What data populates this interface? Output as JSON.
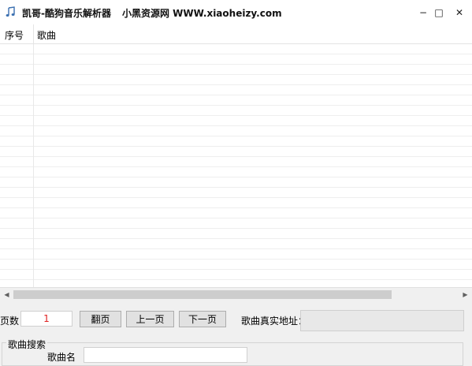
{
  "window": {
    "app_name": "凯哥-酷狗音乐解析器",
    "site_text": "小黑资源网 WWW.xiaoheizy.com",
    "minimize_glyph": "−",
    "maximize_glyph": "□",
    "close_glyph": "✕",
    "icon": "music-note-icon"
  },
  "list": {
    "columns": [
      "序号",
      "歌曲"
    ],
    "rows": []
  },
  "scrollbar": {
    "left_arrow": "◀",
    "right_arrow": "▶"
  },
  "pager": {
    "label": "页数",
    "page_value": "1",
    "flip_button": "翻页",
    "prev_button": "上一页",
    "next_button": "下一页",
    "real_url_label": "歌曲真实地址：",
    "real_url_value": ""
  },
  "search": {
    "group_title": "歌曲搜索",
    "song_name_label": "歌曲名",
    "song_name_value": ""
  },
  "colors": {
    "page_value_color": "#e02020",
    "background": "#f0f0f0"
  }
}
